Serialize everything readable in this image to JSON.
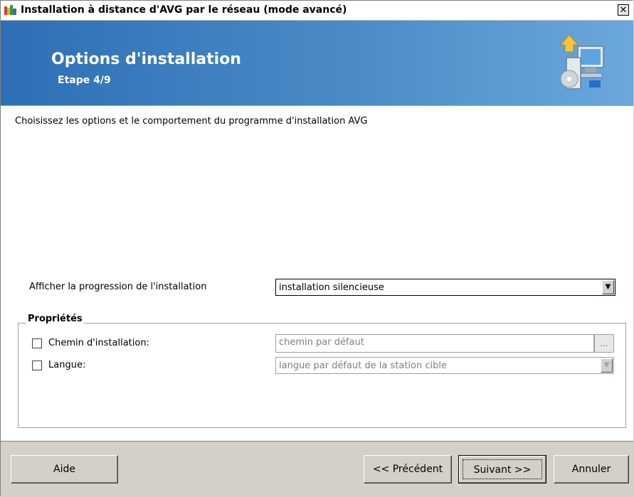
{
  "window": {
    "title": "Installation à distance d'AVG par le réseau (mode avancé)",
    "close_label": "✕"
  },
  "header": {
    "title": "Options d'installation",
    "step": "Etape 4/9"
  },
  "main": {
    "description": "Choisissez les options et le comportement du programme d'installation AVG",
    "progress_label": "Afficher la progression de l'installation",
    "progress_value": "installation silencieuse",
    "properties": {
      "title": "Propriétés",
      "install_path": {
        "label": "Chemin d'installation:",
        "checked": false,
        "value": "chemin par défaut",
        "browse_label": "..."
      },
      "language": {
        "label": "Langue:",
        "checked": false,
        "value": "langue par défaut de la station cible"
      }
    }
  },
  "footer": {
    "help_label": "Aide",
    "prev_label": "<< Précédent",
    "next_label": "Suivant >>",
    "cancel_label": "Annuler"
  },
  "colors": {
    "header_gradient_start": "#2d6fb5",
    "header_gradient_end": "#6aa8dc",
    "dialog_gray": "#d4d0c8"
  },
  "icons": {
    "app": "avg-logo-icon",
    "header": "computer-install-icon",
    "dropdown": "chevron-down-icon"
  }
}
